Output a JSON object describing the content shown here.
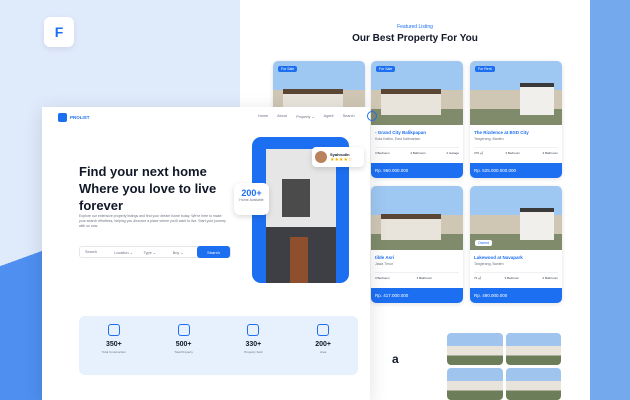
{
  "app": {
    "icon_letter": "F"
  },
  "featured": {
    "kicker": "Featured Listing",
    "title": "Our Best Property For You"
  },
  "cards": [
    {
      "badge": "For Sale",
      "title": "",
      "location": "",
      "features": [
        "",
        "",
        ""
      ],
      "price": ""
    },
    {
      "badge": "For Sale",
      "title": "- Grand City Balikpapan",
      "location": "Kota Kaltim, East Kalimantan",
      "features": [
        "3 Bedroom",
        "3 Bathroom",
        "2 Garage"
      ],
      "price": "Rp. 960.000.000"
    },
    {
      "badge": "For Rent",
      "title": "The Rizdence at BSD City",
      "location": "Tangerang, Banten",
      "features": [
        "379 ㎡",
        "3 Bedroom",
        "3 Bathroom"
      ],
      "price": "Rp. 525.000.000.000"
    },
    {
      "badge": "",
      "title": "tilde Asri",
      "location": "Jawa Timur",
      "features": [
        "3 Bedroom",
        "2 Bathroom",
        ""
      ],
      "price": "Rp. 417.000.000"
    },
    {
      "badge": "Owned",
      "title": "Lakewood at Navapark",
      "location": "Tangerang, Banten",
      "features": [
        "72 ㎡",
        "3 Bedroom",
        "2 Bathroom"
      ],
      "price": "Rp. 490.000.000"
    }
  ],
  "header": {
    "brand": "PROLIST",
    "nav": [
      "Home",
      "About",
      "Property ⌄",
      "Agent",
      "Search"
    ]
  },
  "hero": {
    "headline": "Find your next home Where you love to live forever",
    "description": "Explore our extensive property listings and find your dream home today. We're here to make your search effortless, helping you discover a place where you'll want to live. Start your journey with us now.",
    "available_value": "200+",
    "available_label": "Home Available",
    "reviewer": "Syahrudin",
    "stars": "★★★★☆"
  },
  "search": {
    "placeholder": "Search",
    "location": "Location ⌄",
    "type": "Type ⌄",
    "buy": "Buy ⌄",
    "button": "Search"
  },
  "stats": [
    {
      "value": "350+",
      "label": "Total Construction"
    },
    {
      "value": "500+",
      "label": "Total Property"
    },
    {
      "value": "330+",
      "label": "Property Sold"
    },
    {
      "value": "200+",
      "label": "Area"
    }
  ],
  "bottom_letter": "a"
}
